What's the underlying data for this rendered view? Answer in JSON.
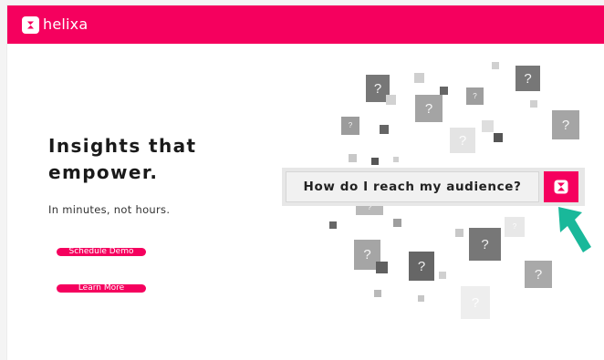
{
  "header": {
    "brand_name": "helixa",
    "logo_icon": "helixa-logo-icon",
    "brand_color": "#f5005e"
  },
  "hero": {
    "headline_line1": "Insights that",
    "headline_line2": "empower.",
    "subheadline": "In minutes, not hours.",
    "primary_cta": "Schedule Demo",
    "secondary_cta": "Learn More"
  },
  "search": {
    "query": "How do I reach my audience?",
    "button_icon": "helixa-logo-icon"
  },
  "decoration": {
    "question_glyph": "?",
    "pointer_icon": "arrow-pointer-icon",
    "pointer_color": "#19b89a"
  }
}
